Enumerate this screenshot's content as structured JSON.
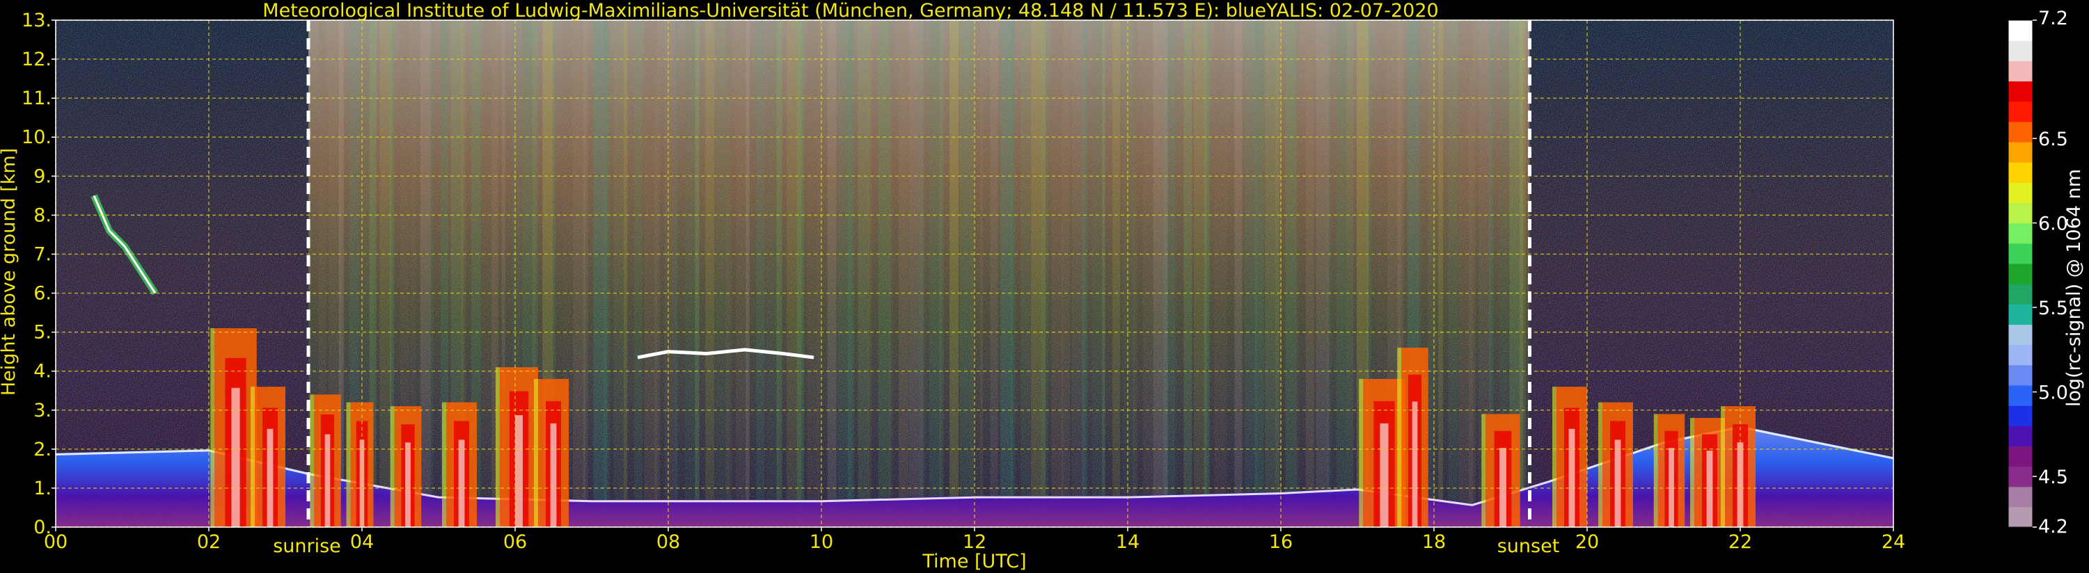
{
  "chart_data": {
    "type": "heatmap",
    "title": "Meteorological Institute of Ludwig-Maximilians-Universität (München, Germany; 48.148 N / 11.573 E):     blueYALIS: 02-07-2020",
    "xlabel": "Time [UTC]",
    "ylabel": "Height above ground [km]",
    "xlim": [
      0,
      24
    ],
    "ylim": [
      0,
      13
    ],
    "x_ticks": [
      "00",
      "02",
      "04",
      "06",
      "08",
      "10",
      "12",
      "14",
      "16",
      "18",
      "20",
      "22",
      "24"
    ],
    "y_ticks": [
      "0.",
      "1.",
      "2.",
      "3.",
      "4.",
      "5.",
      "6.",
      "7.",
      "8.",
      "9.",
      "10.",
      "11.",
      "12.",
      "13."
    ],
    "grid": true,
    "events": [
      {
        "label": "sunrise",
        "time": 3.3
      },
      {
        "label": "sunset",
        "time": 19.25
      }
    ],
    "colorbar": {
      "label": "log(rc-signal) @ 1064 nm",
      "min": 4.2,
      "max": 7.2,
      "tick_labels": [
        "4.2",
        "4.5",
        "5.0",
        "5.5",
        "6.0",
        "6.5",
        "7.2"
      ],
      "tick_values": [
        4.2,
        4.5,
        5.0,
        5.5,
        6.0,
        6.5,
        7.2
      ],
      "colors": [
        "#b69bb0",
        "#a77ea6",
        "#8a2c8c",
        "#7c157e",
        "#4b12b0",
        "#1e30e6",
        "#2a63f6",
        "#6a89f4",
        "#9db5f4",
        "#a9c8e8",
        "#20b49c",
        "#23a564",
        "#1da62b",
        "#3fd25b",
        "#76ef63",
        "#b8f24a",
        "#e4f023",
        "#ffd400",
        "#ffa300",
        "#ff6200",
        "#ff1a00",
        "#e80000",
        "#f3b8b8",
        "#e8e8e8",
        "#ffffff"
      ]
    },
    "features": [
      {
        "name": "boundary-layer",
        "x": [
          0,
          2,
          3.3,
          5,
          7,
          10,
          12,
          14,
          16,
          17,
          18.5,
          19.5,
          21,
          22,
          24
        ],
        "y": [
          1.9,
          2.0,
          1.4,
          0.8,
          0.7,
          0.7,
          0.8,
          0.8,
          0.9,
          1.0,
          0.6,
          1.2,
          2.2,
          2.6,
          1.8
        ]
      },
      {
        "name": "cloud-layer-4.4km",
        "x": [
          7.6,
          8.0,
          8.5,
          9.0,
          9.5,
          9.9
        ],
        "y": [
          4.35,
          4.5,
          4.45,
          4.55,
          4.45,
          4.35
        ]
      },
      {
        "name": "cirrus-7km",
        "x": [
          0.5,
          0.7,
          0.9,
          1.1,
          1.3
        ],
        "y": [
          8.5,
          7.6,
          7.2,
          6.6,
          6.0
        ]
      }
    ]
  }
}
